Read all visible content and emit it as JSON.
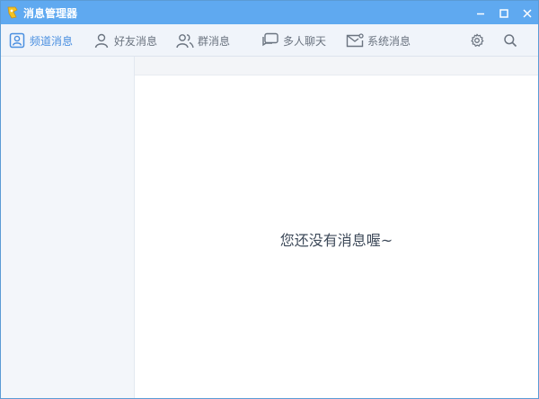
{
  "window": {
    "title": "消息管理器",
    "icons": {
      "app": "app-icon",
      "minimize": "minimize-icon",
      "maximize": "maximize-icon",
      "close": "close-icon"
    }
  },
  "toolbar": {
    "tabs": [
      {
        "label": "频道消息",
        "icon": "channel-icon",
        "active": true
      },
      {
        "label": "好友消息",
        "icon": "friend-icon",
        "active": false
      },
      {
        "label": "群消息",
        "icon": "group-icon",
        "active": false
      },
      {
        "label": "多人聊天",
        "icon": "chat-icon",
        "active": false
      },
      {
        "label": "系统消息",
        "icon": "system-mail-icon",
        "active": false
      }
    ],
    "tools": [
      {
        "name": "settings",
        "icon": "gear-icon"
      },
      {
        "name": "search",
        "icon": "search-icon"
      }
    ]
  },
  "content": {
    "empty_message": "您还没有消息喔~"
  },
  "colors": {
    "titlebar": "#5fa9f0",
    "accent": "#4a8fe0",
    "tab_text": "#6b7480",
    "sidebar_bg": "#f3f6fa",
    "content_bg": "#ffffff"
  }
}
